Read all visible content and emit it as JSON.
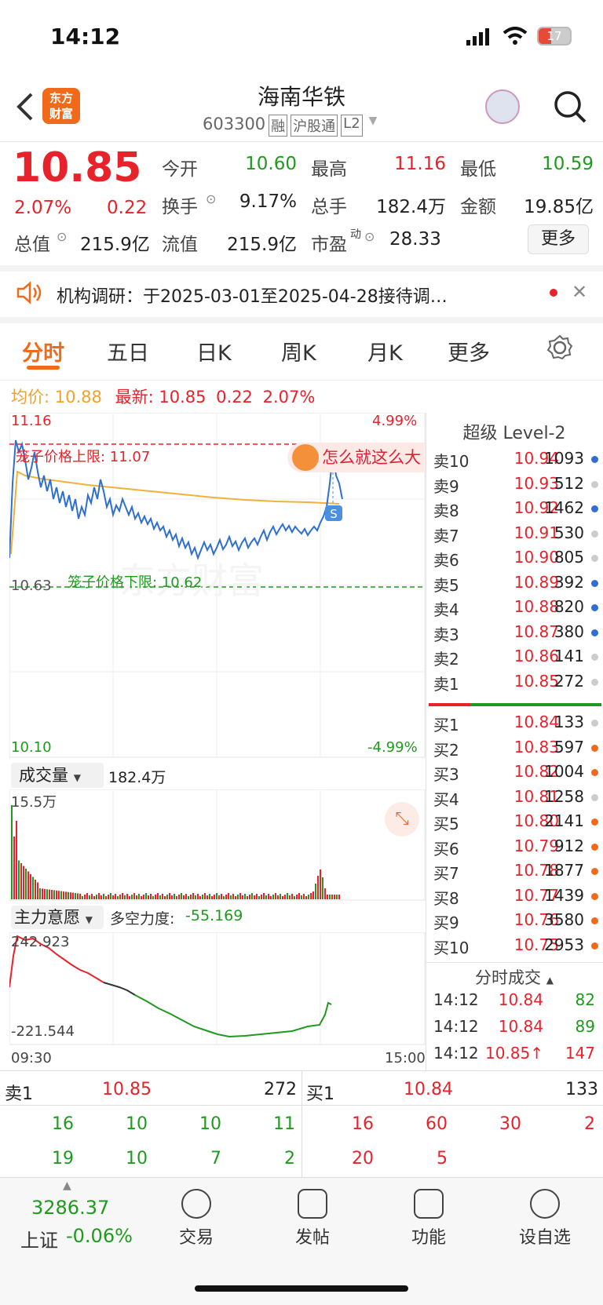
{
  "status": {
    "time": "14:12",
    "battery": "17"
  },
  "header": {
    "title": "海南华铁",
    "code": "603300",
    "tags": [
      "融",
      "沪股通",
      "L2"
    ],
    "logo": "东方\n财富"
  },
  "quote": {
    "price": "10.85",
    "pct": "2.07%",
    "chg": "0.22",
    "rows": [
      [
        {
          "k": "今开",
          "v": "10.60",
          "c": "green"
        },
        {
          "k": "最高",
          "v": "11.16",
          "c": "red"
        },
        {
          "k": "最低",
          "v": "10.59",
          "c": "green"
        }
      ],
      [
        {
          "k": "换手",
          "v": "9.17%",
          "c": "dark"
        },
        {
          "k": "总手",
          "v": "182.4万",
          "c": "dark"
        },
        {
          "k": "金额",
          "v": "19.85亿",
          "c": "dark"
        }
      ],
      [
        {
          "k": "总值",
          "v": "215.9亿",
          "c": "dark"
        },
        {
          "k": "流值",
          "v": "215.9亿",
          "c": "dark"
        },
        {
          "k": "市盈",
          "v": "28.33",
          "c": "dark"
        }
      ]
    ],
    "sup": "动",
    "more": "更多"
  },
  "notice": {
    "text": "机构调研：于2025-03-01至2025-04-28接待调…"
  },
  "tabs": [
    "分时",
    "五日",
    "日K",
    "周K",
    "月K",
    "更多"
  ],
  "avg": {
    "avg_label": "均价:",
    "avg": "10.88",
    "new_label": "最新:",
    "new": "10.85",
    "chg": "0.22",
    "pct": "2.07%"
  },
  "chart": {
    "top": "11.16",
    "bottom": "10.10",
    "mid": "10.63",
    "top_pct": "4.99%",
    "bottom_pct": "-4.99%",
    "upper": "笼子价格上限: 11.07",
    "lower": "笼子价格下限: 10.62",
    "bubble": "怎么就这么大",
    "s": "S",
    "watermark": "东方财富"
  },
  "volume": {
    "label": "成交量",
    "total": "182.4万",
    "max": "15.5万"
  },
  "force": {
    "label": "主力意愿",
    "name": "多空力度:",
    "val": "-55.169",
    "top": "242.923",
    "bottom": "-221.544",
    "t0": "09:30",
    "t1": "15:00"
  },
  "level2": {
    "title": "超级 Level-2",
    "asks": [
      [
        "卖10",
        "10.94",
        "1093",
        "#2f6fd0"
      ],
      [
        "卖9",
        "10.93",
        "512",
        "#ccc"
      ],
      [
        "卖8",
        "10.92",
        "1462",
        "#2f6fd0"
      ],
      [
        "卖7",
        "10.91",
        "530",
        "#ccc"
      ],
      [
        "卖6",
        "10.90",
        "805",
        "#ccc"
      ],
      [
        "卖5",
        "10.89",
        "392",
        "#2f6fd0"
      ],
      [
        "卖4",
        "10.88",
        "820",
        "#2f6fd0"
      ],
      [
        "卖3",
        "10.87",
        "380",
        "#2f6fd0"
      ],
      [
        "卖2",
        "10.86",
        "141",
        "#ccc"
      ],
      [
        "卖1",
        "10.85",
        "272",
        "#ccc"
      ]
    ],
    "bids": [
      [
        "买1",
        "10.84",
        "133",
        "#ccc"
      ],
      [
        "买2",
        "10.83",
        "597",
        "#f06a1a"
      ],
      [
        "买3",
        "10.82",
        "1004",
        "#f06a1a"
      ],
      [
        "买4",
        "10.81",
        "1258",
        "#ccc"
      ],
      [
        "买5",
        "10.80",
        "2141",
        "#f06a1a"
      ],
      [
        "买6",
        "10.79",
        "912",
        "#f06a1a"
      ],
      [
        "买7",
        "10.78",
        "1877",
        "#f06a1a"
      ],
      [
        "买8",
        "10.77",
        "1439",
        "#f06a1a"
      ],
      [
        "买9",
        "10.76",
        "3580",
        "#f06a1a"
      ],
      [
        "买10",
        "10.75",
        "2953",
        "#f06a1a"
      ]
    ],
    "ticks_title": "分时成交",
    "ticks": [
      [
        "14:12",
        "10.84",
        "82",
        "green"
      ],
      [
        "14:12",
        "10.84",
        "89",
        "green"
      ],
      [
        "14:12",
        "10.85↑",
        "147",
        "red"
      ]
    ]
  },
  "queue": {
    "sell_label": "卖1",
    "sell_price": "10.85",
    "sell_vol": "272",
    "buy_label": "买1",
    "buy_price": "10.84",
    "buy_vol": "133",
    "sell_rows": [
      [
        "16",
        "10",
        "10",
        "11"
      ],
      [
        "19",
        "10",
        "7",
        "2"
      ]
    ],
    "buy_rows": [
      [
        "16",
        "60",
        "30",
        "2"
      ],
      [
        "20",
        "5",
        "",
        ""
      ]
    ]
  },
  "bottom": {
    "index": "3286.37",
    "index_name": "上证",
    "index_pct": "-0.06%",
    "items": [
      "交易",
      "发帖",
      "功能",
      "设自选"
    ]
  }
}
